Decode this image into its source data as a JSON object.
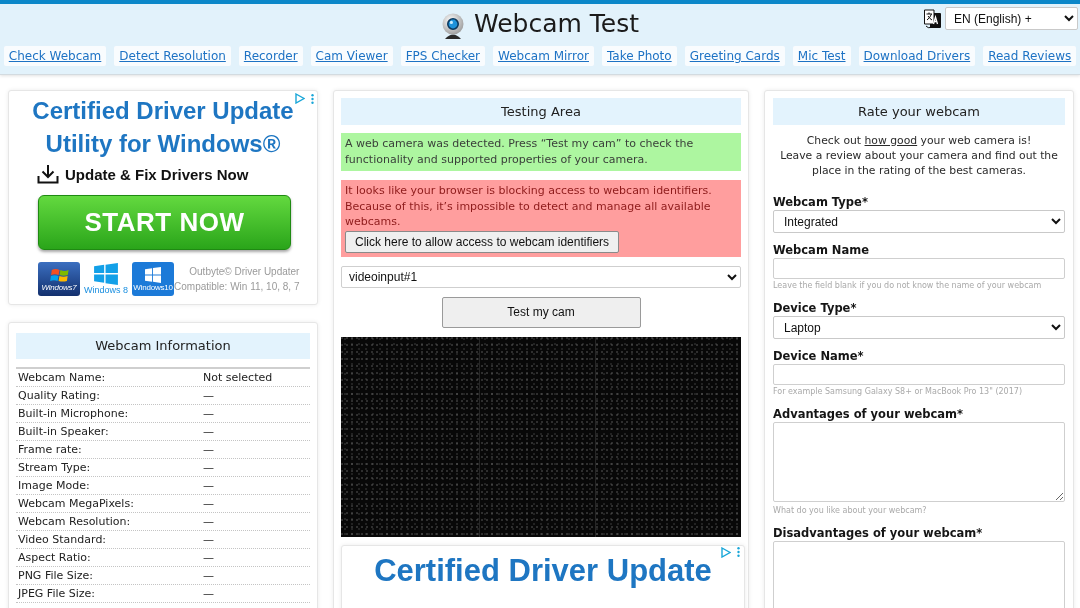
{
  "header": {
    "title": "Webcam Test",
    "language": "EN (English) +",
    "nav": [
      {
        "label": "Check Webcam"
      },
      {
        "label": "Detect Resolution"
      },
      {
        "label": "Recorder"
      },
      {
        "label": "Cam Viewer"
      },
      {
        "label": "FPS Checker"
      },
      {
        "label": "Webcam Mirror"
      },
      {
        "label": "Take Photo"
      },
      {
        "label": "Greeting Cards"
      },
      {
        "label": "Mic Test"
      },
      {
        "label": "Download Drivers"
      },
      {
        "label": "Read Reviews"
      }
    ]
  },
  "side_ad": {
    "headline": [
      "Certified Driver Update",
      "Utility for Windows®"
    ],
    "tagline": "Update & Fix Drivers Now",
    "button": "START NOW",
    "badges": [
      {
        "kind": "win7",
        "label": "Windows7"
      },
      {
        "kind": "win8",
        "label": "Windows 8"
      },
      {
        "kind": "win10",
        "label": "Windows10"
      }
    ],
    "publisher": "Outbyte© Driver Updater",
    "compatibility": "Compatible: Win 11, 10, 8, 7"
  },
  "webcam_info": {
    "title": "Webcam Information",
    "rows": [
      {
        "label": "Webcam Name:",
        "value": "Not selected"
      },
      {
        "label": "Quality Rating:",
        "value": "—"
      },
      {
        "label": "Built-in Microphone:",
        "value": "—"
      },
      {
        "label": "Built-in Speaker:",
        "value": "—"
      },
      {
        "label": "Frame rate:",
        "value": "—"
      },
      {
        "label": "Stream Type:",
        "value": "—"
      },
      {
        "label": "Image Mode:",
        "value": "—"
      },
      {
        "label": "Webcam MegaPixels:",
        "value": "—"
      },
      {
        "label": "Webcam Resolution:",
        "value": "—"
      },
      {
        "label": "Video Standard:",
        "value": "—"
      },
      {
        "label": "Aspect Ratio:",
        "value": "—"
      },
      {
        "label": "PNG File Size:",
        "value": "—"
      },
      {
        "label": "JPEG File Size:",
        "value": "—"
      }
    ]
  },
  "testing_area": {
    "title": "Testing Area",
    "notices": [
      {
        "kind": "success",
        "text": "A web camera was detected. Press “Test my cam” to check the functionality and supported properties of your camera."
      },
      {
        "kind": "error",
        "text": "It looks like your browser is blocking access to webcam identifiers. Because of this, it’s impossible to detect and manage all available webcams.",
        "button": "Click here to allow access to webcam identifiers"
      }
    ],
    "camera_select": "videoinput#1",
    "test_button": "Test my cam",
    "ad": {
      "headline": [
        "Certified Driver Update"
      ]
    }
  },
  "rating_form": {
    "title": "Rate your webcam",
    "intro": {
      "before": "Check out",
      "link": "how good",
      "after": "your web camera is!",
      "note": "Leave a review about your camera and find out the place in the rating of the best cameras."
    },
    "fields": [
      {
        "kind": "select",
        "label": "Webcam Type*",
        "value": "Integrated"
      },
      {
        "kind": "input",
        "label": "Webcam Name",
        "hint": "Leave the field blank if you do not know the name of your webcam"
      },
      {
        "kind": "select",
        "label": "Device Type*",
        "value": "Laptop"
      },
      {
        "kind": "input",
        "label": "Device Name*",
        "hint": "For example Samsung Galaxy S8+ or MacBook Pro 13\" (2017)"
      },
      {
        "kind": "textarea",
        "label": "Advantages of your webcam*",
        "hint": "What do you like about your webcam?"
      },
      {
        "kind": "textarea",
        "label": "Disadvantages of your webcam*"
      }
    ]
  }
}
